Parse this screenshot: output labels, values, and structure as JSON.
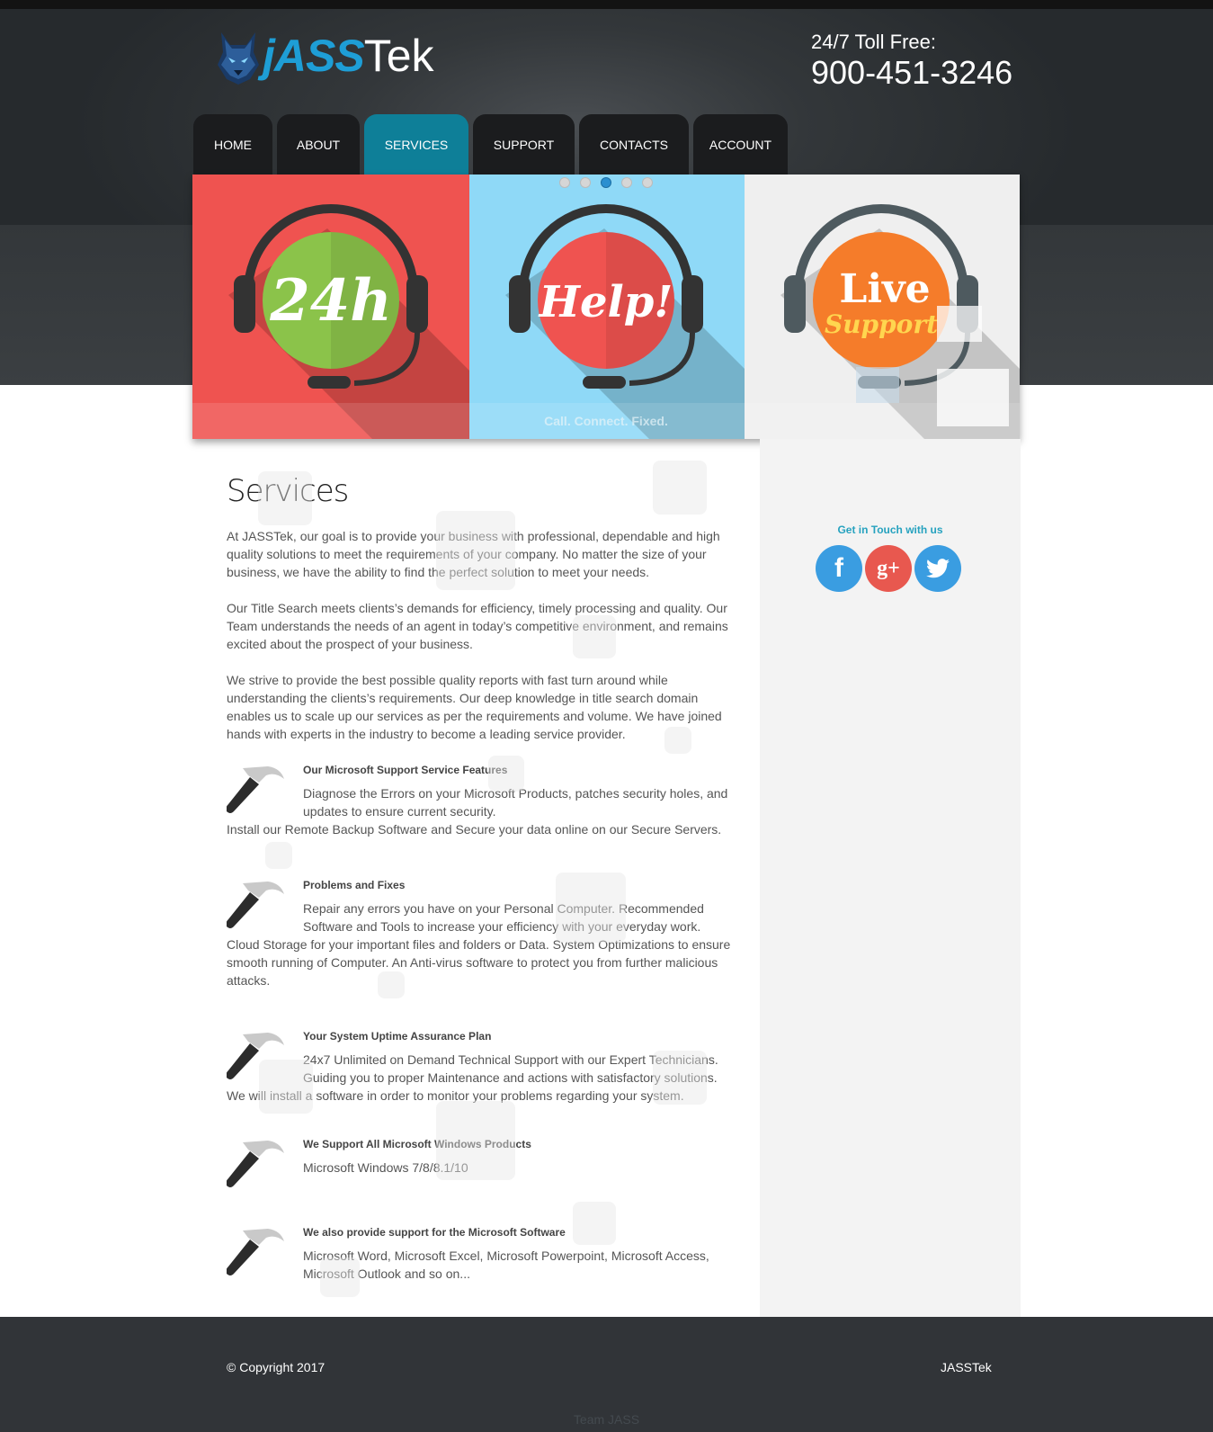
{
  "brand": {
    "name_part1": "jASS",
    "name_part2": "Tek",
    "logo_icon": "wolf-icon"
  },
  "contact": {
    "label": "24/7 Toll Free:",
    "phone": "900-451-3246"
  },
  "nav": {
    "items": [
      {
        "label": "HOME"
      },
      {
        "label": "ABOUT"
      },
      {
        "label": "SERVICES",
        "active": true
      },
      {
        "label": "SUPPORT"
      },
      {
        "label": "CONTACTS"
      },
      {
        "label": "ACCOUNT"
      }
    ]
  },
  "slider": {
    "panels": [
      {
        "text": "24h",
        "bg": "#ef5350",
        "circle": "#8bc34a"
      },
      {
        "text": "Help!",
        "bg": "#8fd9f7",
        "circle": "#ef5350"
      },
      {
        "text_line1": "Live",
        "text_line2": "Support",
        "bg": "#efefef",
        "circle": "#f57c2a"
      }
    ],
    "caption": "Call. Connect. Fixed.",
    "active_slide": 3,
    "total_slides": 5
  },
  "page": {
    "title": "Services",
    "paragraphs": [
      "At JASSTek, our goal is to provide your business with professional, dependable and high quality solutions to meet the requirements of your company. No matter the size of your business, we have the ability to find the perfect solution to meet your needs.",
      "Our Title Search meets clients’s demands for efficiency, timely processing and quality. Our Team understands the needs of an agent in today’s competitive environment, and remains excited about the prospect of your business.",
      "We strive to provide the best possible quality reports with fast turn around while understanding the clients’s requirements. Our deep knowledge in title search domain enables us to scale up our services as per the requirements and volume. We have joined hands with experts in the industry to become a leading service provider."
    ],
    "features": [
      {
        "title": "Our Microsoft Support Service Features",
        "desc": "Diagnose the Errors on your Microsoft Products, patches security holes, and updates to ensure current security.",
        "extra": "Install our Remote Backup Software and Secure your data online on our Secure Servers."
      },
      {
        "title": "Problems and Fixes",
        "desc": "Repair any errors you have on your Personal Computer. Recommended Software and Tools to increase your efficiency with your everyday work.",
        "extra": "Cloud Storage for your important files and folders or Data. System Optimizations to ensure smooth running of Computer. An Anti-virus software to protect you from further malicious attacks."
      },
      {
        "title": "Your System Uptime Assurance Plan",
        "desc": "24x7 Unlimited on Demand Technical Support with our Expert Technicians. Guiding you to proper Maintenance and actions with satisfactory solutions.",
        "extra": "We will install a software in order to monitor your problems regarding your system."
      },
      {
        "title": "We Support All Microsoft Windows Products",
        "desc": "Microsoft Windows 7/8/8.1/10",
        "extra": ""
      },
      {
        "title": "We also provide support for the Microsoft Software",
        "desc": "Microsoft Word, Microsoft Excel, Microsoft Powerpoint, Microsoft Access, Microsoft Outlook and so on...",
        "extra": ""
      }
    ]
  },
  "sidebar": {
    "heading": "Get in Touch with us",
    "social": [
      {
        "icon": "facebook-icon",
        "glyph": "f",
        "color": "#3a9de1"
      },
      {
        "icon": "google-plus-icon",
        "glyph": "g+",
        "color": "#e8584f"
      },
      {
        "icon": "twitter-icon",
        "color": "#3a9de1"
      }
    ]
  },
  "footer": {
    "copyright": "© Copyright 2017",
    "brand": "JASSTek",
    "team": "Team JASS"
  }
}
